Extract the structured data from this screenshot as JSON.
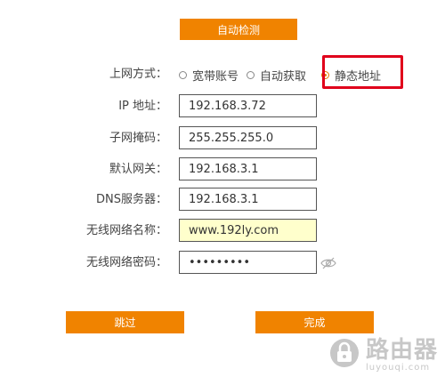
{
  "header": {
    "detect_button": "自动检测"
  },
  "connection": {
    "label": "上网方式：",
    "options": [
      "宽带账号",
      "自动获取",
      "静态地址"
    ],
    "selected_index": 2
  },
  "fields": {
    "ip": {
      "label": "IP 地址：",
      "value": "192.168.3.72"
    },
    "subnet": {
      "label": "子网掩码：",
      "value": "255.255.255.0"
    },
    "gateway": {
      "label": "默认网关：",
      "value": "192.168.3.1"
    },
    "dns": {
      "label": "DNS服务器：",
      "value": "192.168.3.1"
    },
    "ssid": {
      "label": "无线网络名称：",
      "value": "www.192ly.com"
    },
    "password": {
      "label": "无线网络密码：",
      "value": "•••••••••"
    }
  },
  "footer": {
    "skip_button": "跳过",
    "finish_button": "完成"
  },
  "watermark": {
    "cn": "路由器",
    "en": "luyouqi.com"
  },
  "colors": {
    "accent": "#f08300",
    "highlight": "#e0001b",
    "input_highlight": "#ffffcc"
  },
  "icons": {
    "password_toggle": "eye-slash-icon",
    "watermark_logo": "router-logo-icon"
  }
}
